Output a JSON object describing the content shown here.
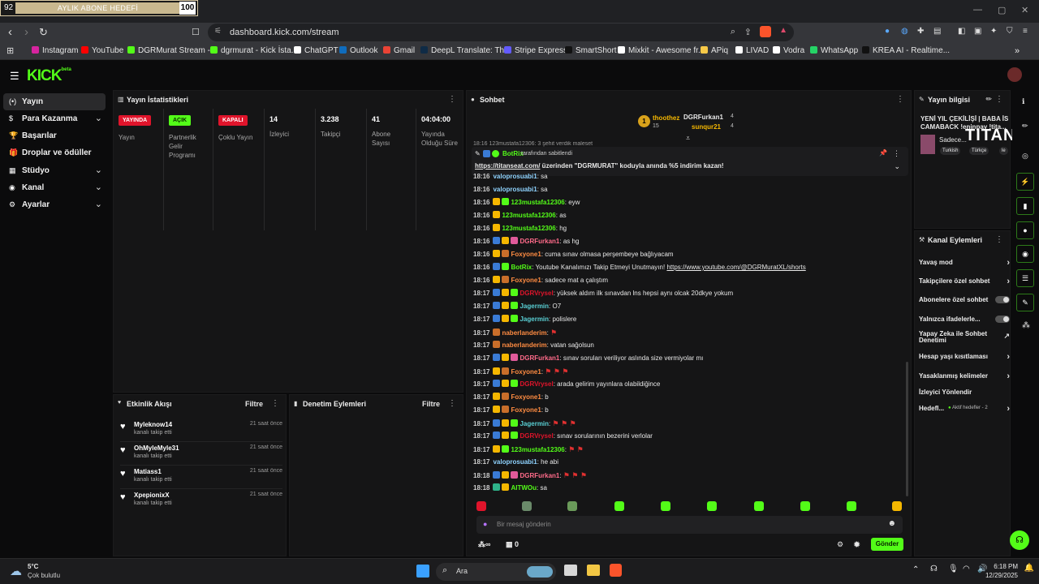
{
  "overlay": {
    "goal_count": "92",
    "goal_label": "AYLIK ABONE HEDEFİ",
    "goal_target": "100",
    "goal_progress": 0.92
  },
  "browser": {
    "url": "dashboard.kick.com/stream",
    "bookmarks": [
      "Instagram",
      "YouTube",
      "DGRMurat Stream -...",
      "dgrmurat - Kick İsta...",
      "ChatGPT",
      "Outlook",
      "Gmail",
      "DeepL Translate: Th...",
      "Stripe Express",
      "SmartShort",
      "Mixkit - Awesome fr...",
      "APiq",
      "LIVAD",
      "Vodra",
      "WhatsApp",
      "KREA AI - Realtime..."
    ],
    "bookmark_colors": [
      "#d6249f",
      "#ff0000",
      "#53fc18",
      "#53fc18",
      "#ffffff",
      "#0f6cbd",
      "#ea4335",
      "#0f2b46",
      "#635bff",
      "#111111",
      "#ffffff",
      "#f7c948",
      "#ffffff",
      "#ffffff",
      "#25d366",
      "#111111"
    ]
  },
  "sidebar": {
    "items": [
      {
        "label": "Yayın",
        "icon": "(•)",
        "chevron": ""
      },
      {
        "label": "Para Kazanma",
        "icon": "$",
        "chevron": "⌄"
      },
      {
        "label": "Başarılar",
        "icon": "🏆",
        "chevron": ""
      },
      {
        "label": "Droplar ve ödüller",
        "icon": "🎁",
        "chevron": ""
      },
      {
        "label": "Stüdyo",
        "icon": "▦",
        "chevron": "⌄"
      },
      {
        "label": "Kanal",
        "icon": "◉",
        "chevron": "⌄"
      },
      {
        "label": "Ayarlar",
        "icon": "⚙",
        "chevron": "⌄"
      }
    ]
  },
  "stats": {
    "title": "Yayın İstatistikleri",
    "badges": [
      {
        "badge": "YAYINDA",
        "label": "Yayın",
        "color": "#e0142b"
      },
      {
        "badge": "AÇIK",
        "label": "Partnerlik Gelir Programı",
        "color": "#53fc18"
      },
      {
        "badge": "KAPALI",
        "label": "Çoklu Yayın",
        "color": "#e0142b"
      }
    ],
    "values": [
      {
        "value": "14",
        "label": "İzleyici"
      },
      {
        "value": "3.238",
        "label": "Takipçi"
      },
      {
        "value": "41",
        "label": "Abone Sayısı"
      },
      {
        "value": "04:04:00",
        "label": "Yayında Olduğu Süre"
      }
    ]
  },
  "activity": {
    "title": "Etkinlik Akışı",
    "filter": "Filtre",
    "items": [
      {
        "name": "Myleknow14",
        "sub": "kanalı takip etti",
        "time": "21 saat önce"
      },
      {
        "name": "OhMyleMyle31",
        "sub": "kanalı takip etti",
        "time": "21 saat önce"
      },
      {
        "name": "Matiass1",
        "sub": "kanalı takip etti",
        "time": "21 saat önce"
      },
      {
        "name": "XpepionixX",
        "sub": "kanalı takip etti",
        "time": "21 saat önce"
      }
    ]
  },
  "moderation": {
    "title": "Denetim Eylemleri",
    "filter": "Filtre"
  },
  "chat": {
    "title": "Sohbet",
    "leaders": [
      {
        "rank": "1",
        "name": "thoothez",
        "count": "15"
      },
      {
        "rank": "",
        "name": "DGRFurkan1",
        "count": "4"
      },
      {
        "rank": "",
        "name": "sunqur21",
        "count": "4"
      }
    ],
    "partial_line": "18:16  123mustafa12306: 3 şehit verdik maleset",
    "pinned_by": "BotRix",
    "pinned_suffix": "tarafından sabitlendi",
    "pinned_link": "https://titanseat.com/",
    "pinned_text": " üzerinden \"DGRMURAT\" koduyla anında %5 indirim kazan!",
    "messages": [
      {
        "time": "18:16",
        "user": "valoprosuabi1",
        "color": "#8fd3ff",
        "badges": [],
        "text": "sa",
        "flags": 0,
        "link": ""
      },
      {
        "time": "18:16",
        "user": "valoprosuabi1",
        "color": "#8fd3ff",
        "badges": [],
        "text": "sa",
        "flags": 0,
        "link": ""
      },
      {
        "time": "18:16",
        "user": "123mustafa12306",
        "color": "#53fc18",
        "badges": [
          "#f5b700",
          "#53fc18"
        ],
        "text": "eyw",
        "flags": 0,
        "link": ""
      },
      {
        "time": "18:16",
        "user": "123mustafa12306",
        "color": "#53fc18",
        "badges": [
          "#f5b700"
        ],
        "text": "as",
        "flags": 0,
        "link": ""
      },
      {
        "time": "18:16",
        "user": "123mustafa12306",
        "color": "#53fc18",
        "badges": [
          "#f5b700"
        ],
        "text": "hg",
        "flags": 0,
        "link": ""
      },
      {
        "time": "18:16",
        "user": "DGRFurkan1",
        "color": "#ff6b8a",
        "badges": [
          "#3a7bd5",
          "#f5b700",
          "#e05a9a"
        ],
        "text": "as hg",
        "flags": 0,
        "link": ""
      },
      {
        "time": "18:16",
        "user": "Foxyone1",
        "color": "#ff8c42",
        "badges": [
          "#f5b700",
          "#c96e2a"
        ],
        "text": "cuma sınav olmasa perşembeye bağlıyacam",
        "flags": 0,
        "link": ""
      },
      {
        "time": "18:16",
        "user": "BotRix",
        "color": "#53fc18",
        "badges": [
          "#3a7bd5",
          "#53fc18"
        ],
        "text": "Youtube Kanalımızı Takip Etmeyi Unutmayın! ",
        "flags": 0,
        "link": "https://www.youtube.com/@DGRMuratXL/shorts"
      },
      {
        "time": "18:16",
        "user": "Foxyone1",
        "color": "#ff8c42",
        "badges": [
          "#f5b700",
          "#c96e2a"
        ],
        "text": "sadece mat a çalıştım",
        "flags": 0,
        "link": ""
      },
      {
        "time": "18:17",
        "user": "DGRVrysel",
        "color": "#e0142b",
        "badges": [
          "#3a7bd5",
          "#f5b700",
          "#53fc18"
        ],
        "text": "yüksek aldım ilk sınavdan lns hepsi aynı olcak 20dkye yokum",
        "flags": 0,
        "link": ""
      },
      {
        "time": "18:17",
        "user": "Jagermin",
        "color": "#5ad1d6",
        "badges": [
          "#3a7bd5",
          "#f5b700",
          "#53fc18"
        ],
        "text": "O7",
        "flags": 0,
        "link": ""
      },
      {
        "time": "18:17",
        "user": "Jagermin",
        "color": "#5ad1d6",
        "badges": [
          "#3a7bd5",
          "#f5b700",
          "#53fc18"
        ],
        "text": "polislere",
        "flags": 0,
        "link": ""
      },
      {
        "time": "18:17",
        "user": "naberlanderim",
        "color": "#ff8c42",
        "badges": [
          "#c96e2a"
        ],
        "text": "",
        "flags": 1,
        "link": ""
      },
      {
        "time": "18:17",
        "user": "naberlanderim",
        "color": "#ff8c42",
        "badges": [
          "#c96e2a"
        ],
        "text": "vatan sağolsun",
        "flags": 0,
        "link": ""
      },
      {
        "time": "18:17",
        "user": "DGRFurkan1",
        "color": "#ff6b8a",
        "badges": [
          "#3a7bd5",
          "#f5b700",
          "#e05a9a"
        ],
        "text": "sınav soruları veriliyor aslında size vermiyolar mı",
        "flags": 0,
        "link": ""
      },
      {
        "time": "18:17",
        "user": "Foxyone1",
        "color": "#ff8c42",
        "badges": [
          "#f5b700",
          "#c96e2a"
        ],
        "text": "",
        "flags": 3,
        "link": ""
      },
      {
        "time": "18:17",
        "user": "DGRVrysel",
        "color": "#e0142b",
        "badges": [
          "#3a7bd5",
          "#f5b700",
          "#53fc18"
        ],
        "text": "arada gelirim yayınlara olabildiğince",
        "flags": 0,
        "link": ""
      },
      {
        "time": "18:17",
        "user": "Foxyone1",
        "color": "#ff8c42",
        "badges": [
          "#f5b700",
          "#c96e2a"
        ],
        "text": "b",
        "flags": 0,
        "link": ""
      },
      {
        "time": "18:17",
        "user": "Foxyone1",
        "color": "#ff8c42",
        "badges": [
          "#f5b700",
          "#c96e2a"
        ],
        "text": "b",
        "flags": 0,
        "link": ""
      },
      {
        "time": "18:17",
        "user": "Jagermin",
        "color": "#5ad1d6",
        "badges": [
          "#3a7bd5",
          "#f5b700",
          "#53fc18"
        ],
        "text": "",
        "flags": 3,
        "link": ""
      },
      {
        "time": "18:17",
        "user": "DGRVrysel",
        "color": "#e0142b",
        "badges": [
          "#3a7bd5",
          "#f5b700",
          "#53fc18"
        ],
        "text": "sınav sorularının bezerini verlolar",
        "flags": 0,
        "link": ""
      },
      {
        "time": "18:17",
        "user": "123mustafa12306",
        "color": "#53fc18",
        "badges": [
          "#f5b700",
          "#53fc18"
        ],
        "text": "",
        "flags": 2,
        "link": ""
      },
      {
        "time": "18:17",
        "user": "valoprosuabi1",
        "color": "#8fd3ff",
        "badges": [],
        "text": "he abi",
        "flags": 0,
        "link": ""
      },
      {
        "time": "18:18",
        "user": "DGRFurkan1",
        "color": "#ff6b8a",
        "badges": [
          "#3a7bd5",
          "#f5b700",
          "#e05a9a"
        ],
        "text": "",
        "flags": 3,
        "link": ""
      },
      {
        "time": "18:18",
        "user": "AITWOu",
        "color": "#53fc18",
        "badges": [
          "#2fb38a",
          "#f5b700"
        ],
        "text": "sa",
        "flags": 0,
        "link": ""
      }
    ],
    "input_placeholder": "Bir mesaj gönderin",
    "points": "∞",
    "gift_count": "0",
    "send_label": "Gönder"
  },
  "stream_info": {
    "title": "Yayın bilgisi",
    "stream_title": "YENİ YIL ÇEKİLİŞİ | BABA İS CAMABACK !eninpay !tita...",
    "category": "Sadece...",
    "tags": [
      "Turkish",
      "Türkçe",
      "le"
    ],
    "brand": "TITAN"
  },
  "channel_actions": {
    "title": "Kanal Eylemleri",
    "items": [
      {
        "label": "Yavaş mod",
        "control": "arrow",
        "sub": ""
      },
      {
        "label": "Takipçilere özel sohbet",
        "control": "arrow",
        "sub": ""
      },
      {
        "label": "Abonelere özel sohbet",
        "control": "toggle",
        "sub": ""
      },
      {
        "label": "Yalnızca ifadelerle...",
        "control": "toggle",
        "sub": ""
      },
      {
        "label": "Yapay Zeka ile Sohbet Denetimi",
        "control": "external",
        "sub": ""
      },
      {
        "label": "Hesap yaşı kısıtlaması",
        "control": "arrow",
        "sub": ""
      },
      {
        "label": "Yasaklanmış kelimeler",
        "control": "arrow",
        "sub": ""
      },
      {
        "label": "İzleyici Yönlendir",
        "control": "none",
        "sub": ""
      },
      {
        "label": "Hedefl...",
        "control": "arrow",
        "sub": "Aktif hedefler - 2"
      }
    ]
  },
  "taskbar": {
    "temp": "5°C",
    "weather": "Çok bulutlu",
    "search": "Ara",
    "time": "6:18 PM",
    "date": "12/29/2025"
  }
}
